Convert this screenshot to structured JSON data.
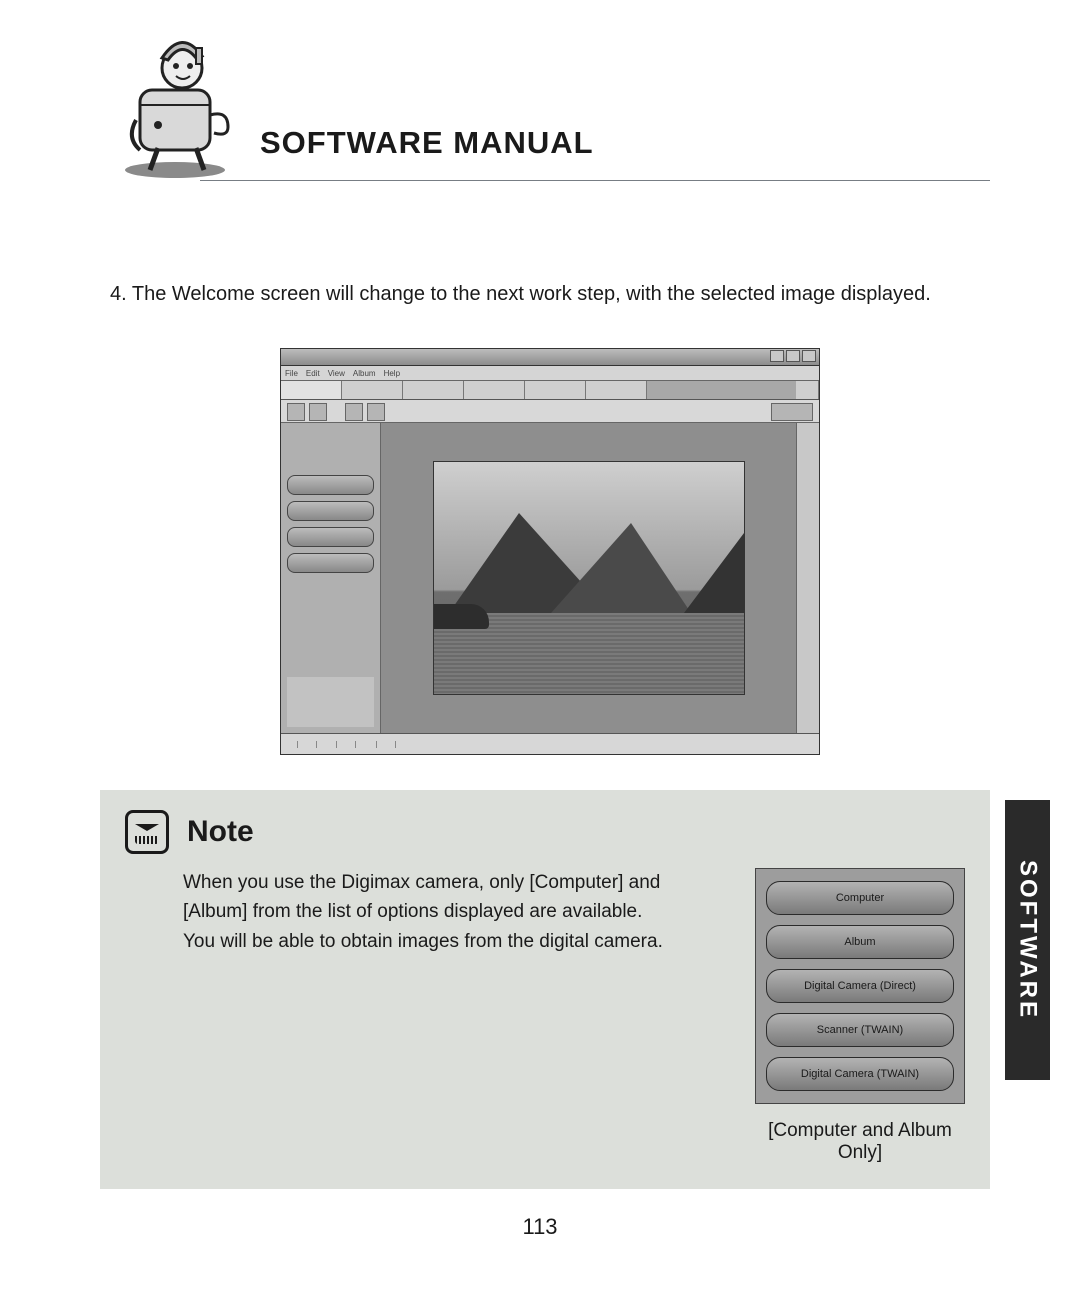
{
  "header": {
    "title": "SOFTWARE MANUAL"
  },
  "step": {
    "text": "4. The Welcome screen will change to the next work step, with the selected image displayed."
  },
  "screenshot": {
    "menus": [
      "File",
      "Edit",
      "View",
      "Album",
      "Help"
    ],
    "sidebar_buttons": [
      "",
      "",
      "",
      ""
    ]
  },
  "note": {
    "heading": "Note",
    "body_line1": "When you use the Digimax camera, only [Computer] and",
    "body_line2": "[Album] from the list of options displayed are available.",
    "body_line3": "You will be able to obtain images from the digital camera.",
    "options": [
      "Computer",
      "Album",
      "Digital Camera (Direct)",
      "Scanner (TWAIN)",
      "Digital Camera (TWAIN)"
    ],
    "caption": "[Computer and Album Only]"
  },
  "side_tab": "SOFTWARE",
  "page_number": "113"
}
